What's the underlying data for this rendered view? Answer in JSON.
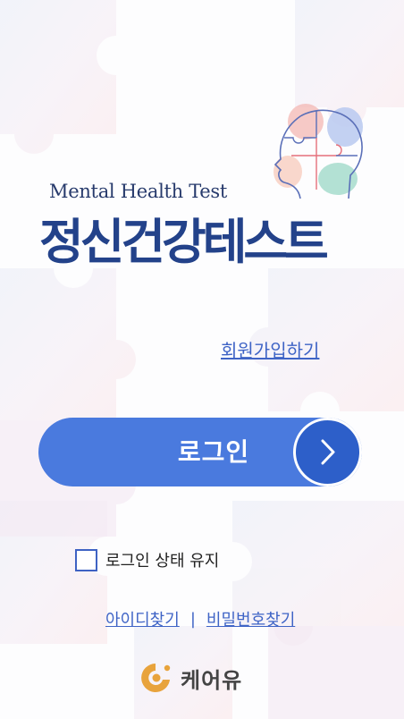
{
  "header": {
    "subtitle": "Mental Health Test",
    "title": "정신건강테스트"
  },
  "actions": {
    "signup_label": "회원가입하기",
    "login_label": "로그인"
  },
  "remember": {
    "label": "로그인 상태 유지",
    "checked": false
  },
  "find_links": {
    "find_id": "아이디찾기",
    "separator": "|",
    "find_password": "비밀번호찾기"
  },
  "brand": {
    "name": "케어유",
    "icon": "care-you-logo-icon"
  },
  "colors": {
    "primary": "#4a7ade",
    "primary_dark": "#2d5fc9",
    "title": "#23428a",
    "link": "#3f64c6",
    "brand_accent": "#e8a33c"
  }
}
